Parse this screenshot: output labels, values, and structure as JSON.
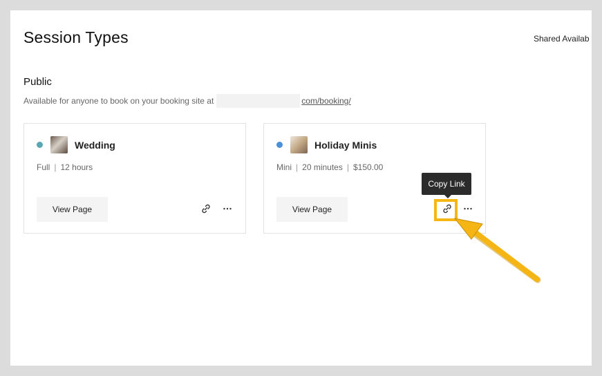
{
  "page": {
    "title": "Session Types",
    "shared_availability_label": "Shared Availab"
  },
  "section": {
    "title": "Public",
    "description": "Available for anyone to book on your booking site at",
    "booking_link": "com/booking/"
  },
  "cards": [
    {
      "name": "Wedding",
      "dot_color": "#5aa7b2",
      "thumbnail": "wedding-photo",
      "meta": [
        "Full",
        "12 hours"
      ],
      "view_label": "View Page"
    },
    {
      "name": "Holiday Minis",
      "dot_color": "#4a90d9",
      "thumbnail": "holiday-photo",
      "meta": [
        "Mini",
        "20 minutes",
        "$150.00"
      ],
      "view_label": "View Page"
    }
  ],
  "tooltip": {
    "text": "Copy Link"
  },
  "colors": {
    "highlight": "#f5b515",
    "background": "#dcdcdc"
  },
  "icons": {
    "link": "link-icon",
    "more": "more-icon"
  }
}
